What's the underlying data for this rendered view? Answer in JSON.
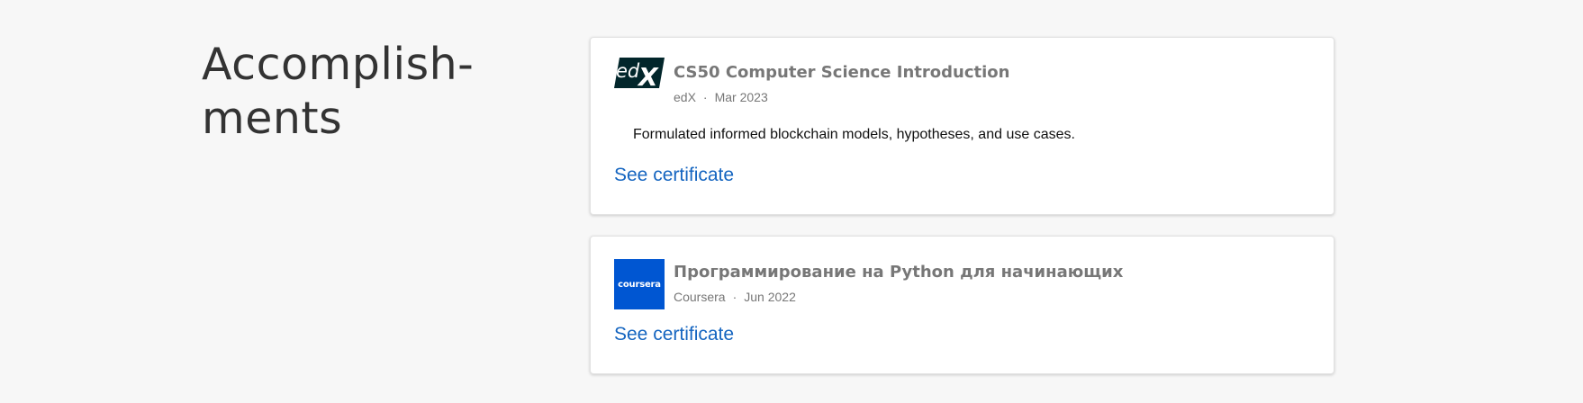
{
  "section": {
    "title": "Accomplish-\nments"
  },
  "certificates": [
    {
      "logo_icon": "edx-logo-icon",
      "title": "CS50 Computer Science Introduction",
      "issuer": "edX",
      "separator": "·",
      "date": "Mar 2023",
      "description": "Formulated informed blockchain models, hypotheses, and use cases.",
      "link_label": "See certificate"
    },
    {
      "logo_icon": "coursera-logo-icon",
      "logo_text": "coursera",
      "title": "Программирование на Python для начинающих",
      "issuer": "Coursera",
      "separator": "·",
      "date": "Jun 2022",
      "link_label": "See certificate"
    }
  ],
  "colors": {
    "page_background": "#f7f7f7",
    "card_background": "#ffffff",
    "heading": "#333333",
    "muted_text": "#777777",
    "link": "#1565c0",
    "edx_brand": "#02262b",
    "coursera_brand": "#0056d2"
  }
}
